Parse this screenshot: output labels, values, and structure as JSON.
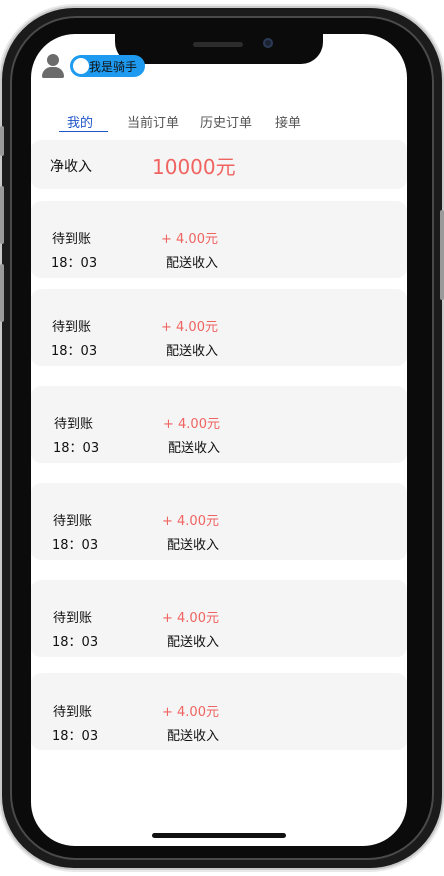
{
  "header": {
    "toggle_label": "我是骑手"
  },
  "tabs": [
    {
      "label": "我的"
    },
    {
      "label": "当前订单"
    },
    {
      "label": "历史订单"
    },
    {
      "label": "接单"
    }
  ],
  "summary": {
    "label": "净收入",
    "value": "10000元"
  },
  "entries": [
    {
      "status": "待到账",
      "amount": "+ 4.00元",
      "time": "18：03",
      "type": "配送收入"
    },
    {
      "status": "待到账",
      "amount": "+ 4.00元",
      "time": "18：03",
      "type": "配送收入"
    },
    {
      "status": "待到账",
      "amount": "+ 4.00元",
      "time": "18：03",
      "type": "配送收入"
    },
    {
      "status": "待到账",
      "amount": "+ 4.00元",
      "time": "18：03",
      "type": "配送收入"
    },
    {
      "status": "待到账",
      "amount": "+ 4.00元",
      "time": "18：03",
      "type": "配送收入"
    },
    {
      "status": "待到账",
      "amount": "+ 4.00元",
      "time": "18：03",
      "type": "配送收入"
    }
  ],
  "colors": {
    "accent": "#1e56c8",
    "toggle": "#1e9bf0",
    "amount": "#ef6461",
    "card": "#f5f5f5"
  }
}
